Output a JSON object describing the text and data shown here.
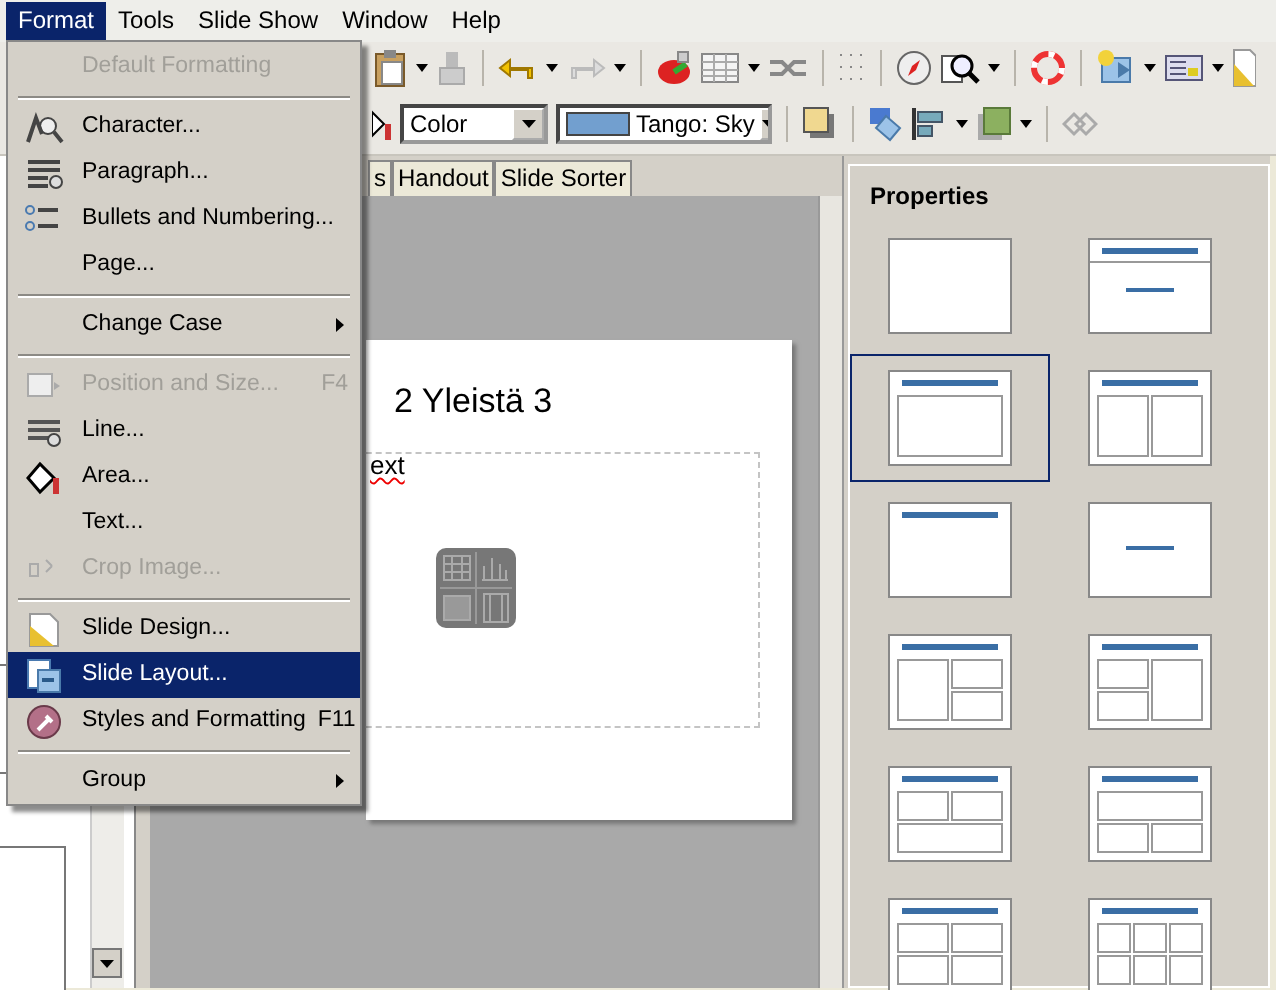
{
  "menubar": [
    {
      "label": "Format",
      "selected": true
    },
    {
      "label": "Tools",
      "selected": false
    },
    {
      "label": "Slide Show",
      "selected": false
    },
    {
      "label": "Window",
      "selected": false
    },
    {
      "label": "Help",
      "selected": false
    }
  ],
  "menu": [
    {
      "kind": "item",
      "label": "Default Formatting",
      "disabled": true,
      "selected": false
    },
    {
      "kind": "separator"
    },
    {
      "kind": "item",
      "label": "Character...",
      "disabled": false,
      "selected": false
    },
    {
      "kind": "item",
      "label": "Paragraph...",
      "disabled": false,
      "selected": false
    },
    {
      "kind": "item",
      "label": "Bullets and Numbering...",
      "disabled": false,
      "selected": false
    },
    {
      "kind": "item",
      "label": "Page...",
      "disabled": false,
      "selected": false
    },
    {
      "kind": "separator"
    },
    {
      "kind": "submenu",
      "label": "Change Case",
      "disabled": false,
      "selected": false
    },
    {
      "kind": "separator"
    },
    {
      "kind": "item",
      "label": "Position and Size...",
      "shortcut": "F4",
      "disabled": true,
      "selected": false
    },
    {
      "kind": "item",
      "label": "Line...",
      "disabled": false,
      "selected": false
    },
    {
      "kind": "item",
      "label": "Area...",
      "disabled": false,
      "selected": false
    },
    {
      "kind": "item",
      "label": "Text...",
      "disabled": false,
      "selected": false
    },
    {
      "kind": "item",
      "label": "Crop Image...",
      "disabled": true,
      "selected": false
    },
    {
      "kind": "separator"
    },
    {
      "kind": "item",
      "label": "Slide Design...",
      "disabled": false,
      "selected": false
    },
    {
      "kind": "item",
      "label": "Slide Layout...",
      "disabled": false,
      "selected": true
    },
    {
      "kind": "item",
      "label": "Styles and Formatting",
      "shortcut": "F11",
      "disabled": false,
      "selected": false
    },
    {
      "kind": "separator"
    },
    {
      "kind": "submenu",
      "label": "Group",
      "disabled": false,
      "selected": false
    }
  ],
  "drawing_toolbar": {
    "area_style": "Color",
    "area_fill": "Tango: Sky"
  },
  "view_tabs": [
    {
      "label": "s",
      "selected": false
    },
    {
      "label": "Handout",
      "selected": false
    },
    {
      "label": "Slide Sorter",
      "selected": false
    }
  ],
  "slide": {
    "title": "2 Yleistä 3",
    "body": "ext"
  },
  "properties": {
    "title": "Properties",
    "layouts": [
      {
        "kind": "blank",
        "selected": false
      },
      {
        "kind": "title-subtitle",
        "selected": false
      },
      {
        "kind": "title-content",
        "selected": true
      },
      {
        "kind": "title-two-columns",
        "selected": false
      },
      {
        "kind": "title-only",
        "selected": false
      },
      {
        "kind": "centered-text",
        "selected": false
      },
      {
        "kind": "title-left-big-right-two",
        "selected": false
      },
      {
        "kind": "title-left-two-right-big",
        "selected": false
      },
      {
        "kind": "title-two-top-one-bottom",
        "selected": false
      },
      {
        "kind": "title-one-top-two-bottom",
        "selected": false
      },
      {
        "kind": "title-four",
        "selected": false
      },
      {
        "kind": "title-six",
        "selected": false
      }
    ]
  }
}
